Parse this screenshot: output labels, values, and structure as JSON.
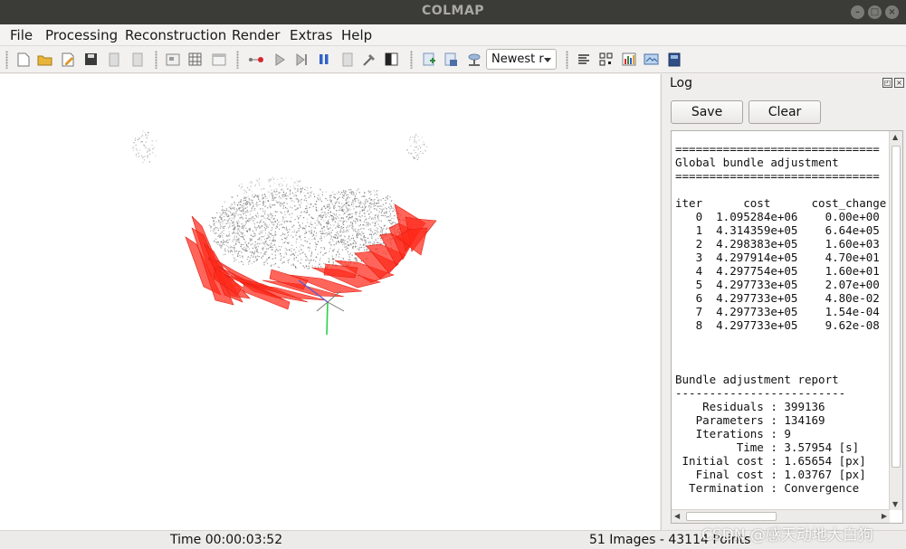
{
  "window": {
    "title": "COLMAP"
  },
  "menu": [
    "File",
    "Processing",
    "Reconstruction",
    "Render",
    "Extras",
    "Help"
  ],
  "toolbar": {
    "icons": [
      "new-project-icon",
      "open-project-icon",
      "edit-project-icon",
      "save-project-icon",
      "import-icon",
      "export-icon",
      "feature-extraction-icon",
      "feature-matching-icon",
      "database-icon",
      "automatic-reconstruction-icon",
      "start-reconstruction-icon",
      "step-reconstruction-icon",
      "pause-reconstruction-icon",
      "reset-icon",
      "bundle-adjustment-icon",
      "dense-reconstruction-icon",
      "render-options-icon",
      "reconstruction-stats-icon",
      "match-matrix-icon",
      "log-icon",
      "grab-image-icon",
      "grab-movie-icon"
    ],
    "model_select": "Newest r"
  },
  "log_panel": {
    "title": "Log",
    "save_label": "Save",
    "clear_label": "Clear",
    "lines": [
      "==============================",
      "Global bundle adjustment",
      "==============================",
      "",
      "iter      cost      cost_change",
      "   0  1.095284e+06    0.00e+00",
      "   1  4.314359e+05    6.64e+05",
      "   2  4.298383e+05    1.60e+03",
      "   3  4.297914e+05    4.70e+01",
      "   4  4.297754e+05    1.60e+01",
      "   5  4.297733e+05    2.07e+00",
      "   6  4.297733e+05    4.80e-02",
      "   7  4.297733e+05    1.54e-04",
      "   8  4.297733e+05    9.62e-08",
      "",
      "",
      "",
      "Bundle adjustment report",
      "-------------------------",
      "    Residuals : 399136",
      "   Parameters : 134169",
      "   Iterations : 9",
      "         Time : 3.57954 [s]",
      " Initial cost : 1.65654 [px]",
      "   Final cost : 1.03767 [px]",
      "  Termination : Convergence"
    ]
  },
  "status": {
    "time": "Time 00:00:03:52",
    "counts": "51 Images - 43114 Points"
  },
  "watermark": "CSDN @感天动地大白狗",
  "colors": {
    "camera_frustum": "#ff2a1a",
    "point_cloud": "#8a8a8a",
    "title_bar": "#3b3b38"
  }
}
